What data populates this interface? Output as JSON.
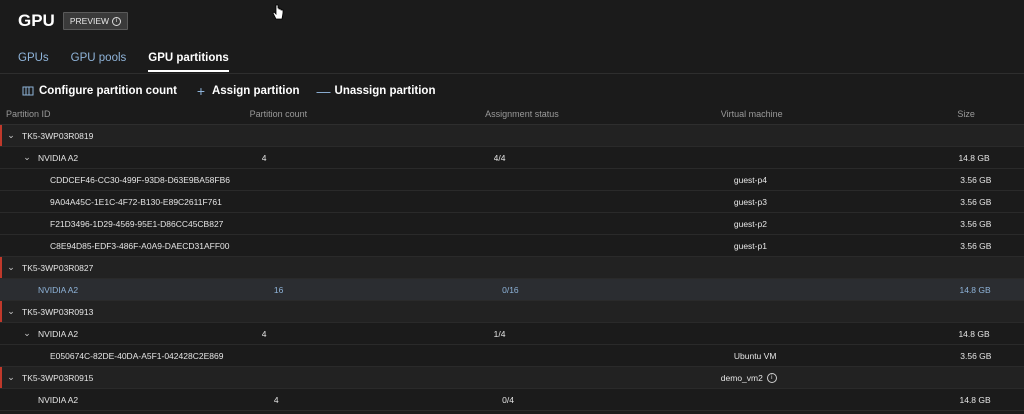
{
  "header": {
    "title": "GPU",
    "badge": "PREVIEW"
  },
  "tabs": [
    {
      "label": "GPUs"
    },
    {
      "label": "GPU pools"
    },
    {
      "label": "GPU partitions"
    }
  ],
  "toolbar": {
    "configure": "Configure partition count",
    "assign": "Assign partition",
    "unassign": "Unassign partition"
  },
  "columns": {
    "id": "Partition ID",
    "count": "Partition count",
    "status": "Assignment status",
    "vm": "Virtual machine",
    "size": "Size"
  },
  "rows": [
    {
      "id": "TK5-3WP03R0819",
      "count": "",
      "status": "",
      "vm": "",
      "size": ""
    },
    {
      "id": "NVIDIA A2",
      "count": "4",
      "status": "4/4",
      "vm": "",
      "size": "14.8 GB"
    },
    {
      "id": "CDDCEF46-CC30-499F-93D8-D63E9BA58FB6",
      "count": "",
      "status": "",
      "vm": "guest-p4",
      "size": "3.56 GB"
    },
    {
      "id": "9A04A45C-1E1C-4F72-B130-E89C2611F761",
      "count": "",
      "status": "",
      "vm": "guest-p3",
      "size": "3.56 GB"
    },
    {
      "id": "F21D3496-1D29-4569-95E1-D86CC45CB827",
      "count": "",
      "status": "",
      "vm": "guest-p2",
      "size": "3.56 GB"
    },
    {
      "id": "C8E94D85-EDF3-486F-A0A9-DAECD31AFF00",
      "count": "",
      "status": "",
      "vm": "guest-p1",
      "size": "3.56 GB"
    },
    {
      "id": "TK5-3WP03R0827",
      "count": "",
      "status": "",
      "vm": "",
      "size": ""
    },
    {
      "id": "NVIDIA A2",
      "count": "16",
      "status": "0/16",
      "vm": "",
      "size": "14.8 GB"
    },
    {
      "id": "TK5-3WP03R0913",
      "count": "",
      "status": "",
      "vm": "",
      "size": ""
    },
    {
      "id": "NVIDIA A2",
      "count": "4",
      "status": "1/4",
      "vm": "",
      "size": "14.8 GB"
    },
    {
      "id": "E050674C-82DE-40DA-A5F1-042428C2E869",
      "count": "",
      "status": "",
      "vm": "Ubuntu VM",
      "size": "3.56 GB"
    },
    {
      "id": "TK5-3WP03R0915",
      "count": "",
      "status": "",
      "vm": "demo_vm2",
      "size": ""
    },
    {
      "id": "NVIDIA A2",
      "count": "4",
      "status": "0/4",
      "vm": "",
      "size": "14.8 GB"
    }
  ]
}
